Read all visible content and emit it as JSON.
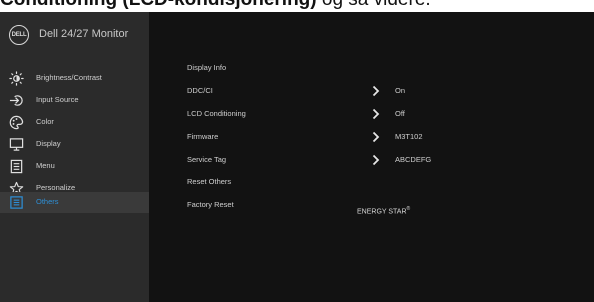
{
  "page_caption": {
    "bold_text": "Conditioning (LCD-kondisjonering)",
    "normal_text": " og så videre."
  },
  "header": {
    "logo_text": "DELL",
    "model": "Dell 24/27 Monitor"
  },
  "sidebar": {
    "items": [
      {
        "label": "Brightness/Contrast",
        "icon": "brightness-icon"
      },
      {
        "label": "Input Source",
        "icon": "input-source-icon"
      },
      {
        "label": "Color",
        "icon": "color-palette-icon"
      },
      {
        "label": "Display",
        "icon": "display-icon"
      },
      {
        "label": "Menu",
        "icon": "menu-icon"
      },
      {
        "label": "Personalize",
        "icon": "star-icon"
      },
      {
        "label": "Others",
        "icon": "others-icon",
        "selected": true
      }
    ]
  },
  "others": {
    "rows": [
      {
        "label": "Display Info",
        "value": ""
      },
      {
        "label": "DDC/CI",
        "value": "On",
        "has_arrow": true
      },
      {
        "label": "LCD Conditioning",
        "value": "Off",
        "has_arrow": true
      },
      {
        "label": "Firmware",
        "value": "M3T102",
        "has_arrow": true
      },
      {
        "label": "Service Tag",
        "value": "ABCDEFG",
        "has_arrow": true
      },
      {
        "label": "Reset Others",
        "value": ""
      },
      {
        "label": "Factory Reset",
        "value": ""
      }
    ],
    "energy_star": "ENERGY STAR",
    "energy_star_mark": "®"
  },
  "colors": {
    "sidebar_bg": "#2b2b2b",
    "panel_bg": "#121212",
    "selected_bg": "#3a3a3a",
    "accent": "#2e8fd6",
    "text": "#cfcfcf"
  }
}
